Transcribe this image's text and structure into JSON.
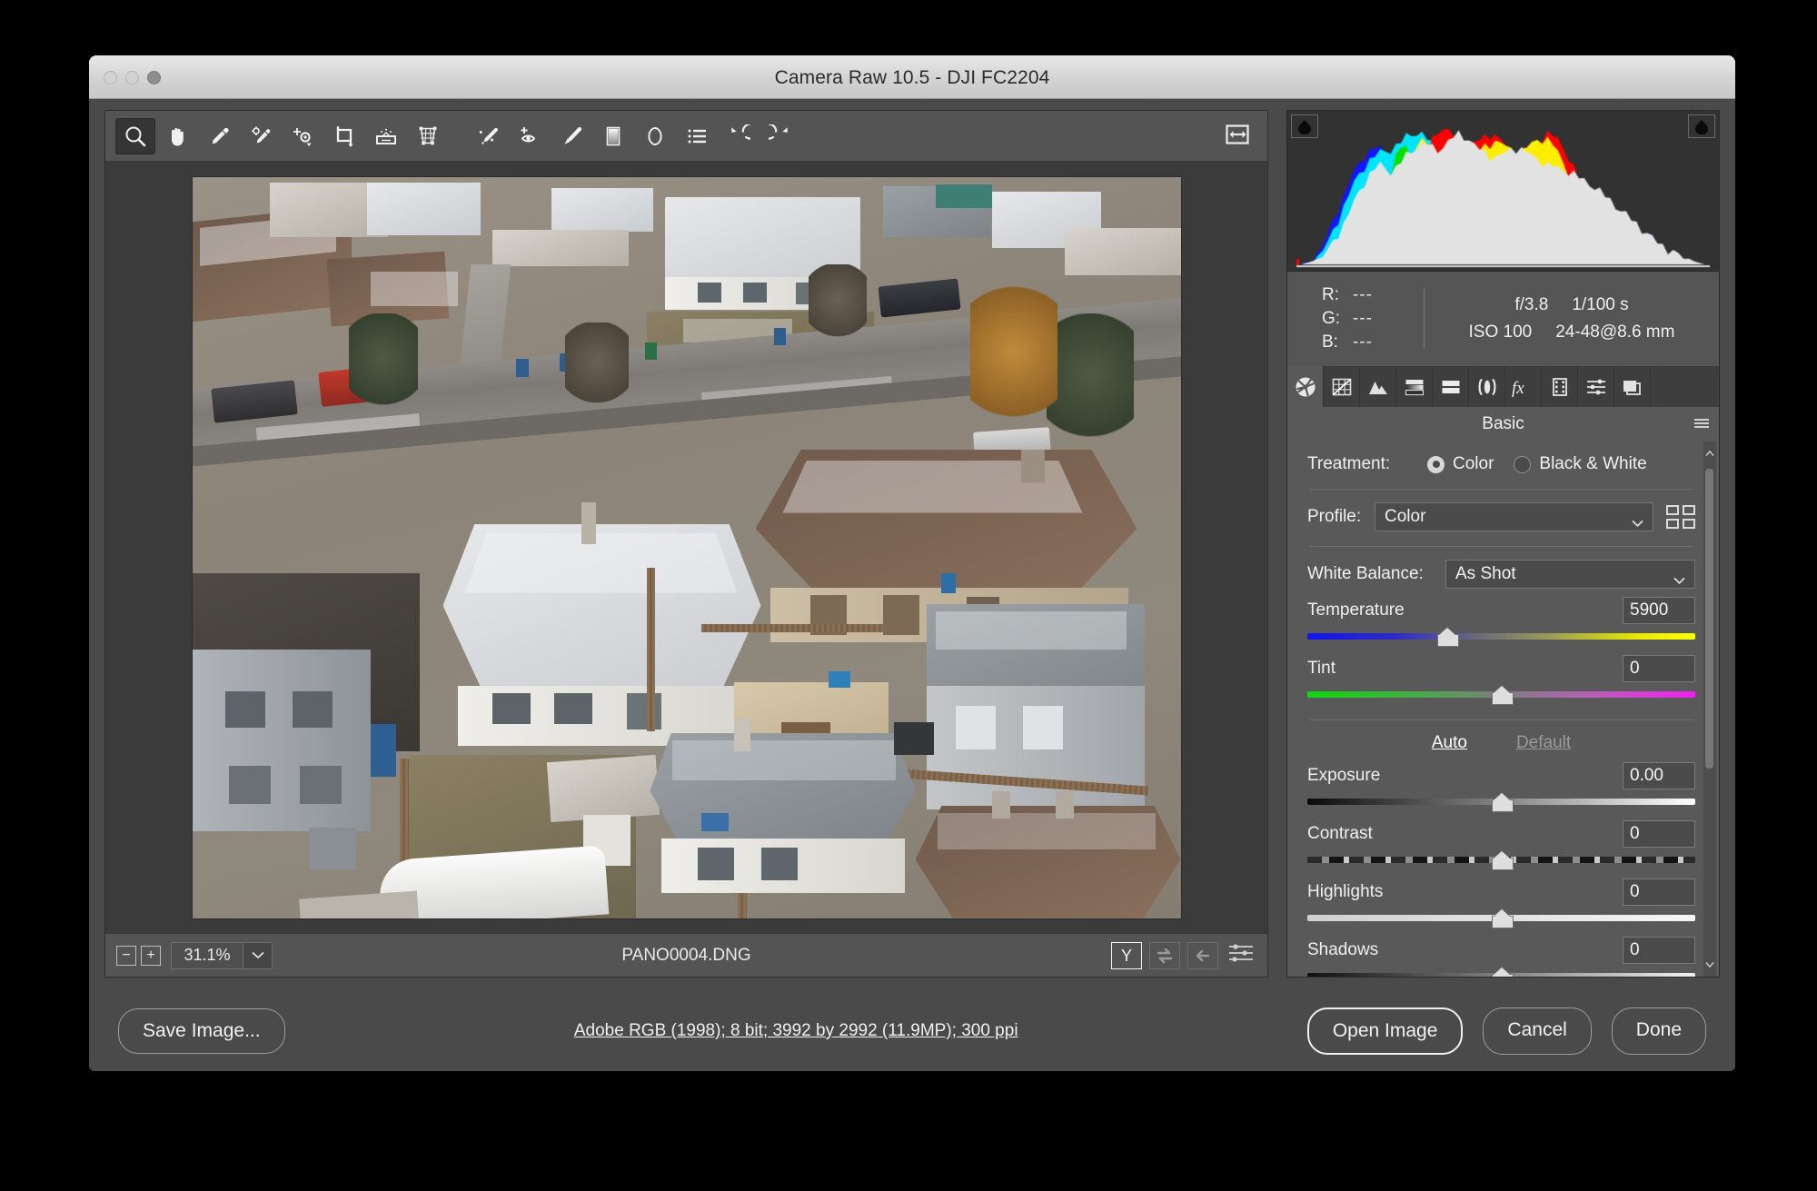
{
  "window": {
    "title": "Camera Raw 10.5  -  DJI FC2204",
    "traffic_lights": [
      "close",
      "minimize",
      "zoom"
    ]
  },
  "toolbar": {
    "tools": [
      {
        "name": "zoom-tool",
        "label": "Zoom Tool",
        "active": true
      },
      {
        "name": "hand-tool",
        "label": "Hand Tool",
        "active": false
      },
      {
        "name": "white-balance-tool",
        "label": "White Balance Tool",
        "active": false
      },
      {
        "name": "color-sampler-tool",
        "label": "Color Sampler Tool",
        "active": false
      },
      {
        "name": "targeted-adjustment-tool",
        "label": "Targeted Adjustment Tool",
        "active": false
      },
      {
        "name": "crop-tool",
        "label": "Crop Tool",
        "active": false
      },
      {
        "name": "straighten-tool",
        "label": "Straighten Tool",
        "active": false
      },
      {
        "name": "transform-tool",
        "label": "Transform Tool",
        "active": false
      },
      {
        "name": "spot-removal-tool",
        "label": "Spot Removal",
        "active": false
      },
      {
        "name": "red-eye-removal-tool",
        "label": "Red Eye Removal",
        "active": false
      },
      {
        "name": "adjustment-brush-tool",
        "label": "Adjustment Brush",
        "active": false
      },
      {
        "name": "graduated-filter-tool",
        "label": "Graduated Filter",
        "active": false
      },
      {
        "name": "radial-filter-tool",
        "label": "Radial Filter",
        "active": false
      },
      {
        "name": "preferences-tool",
        "label": "Open Preferences Dialog",
        "active": false
      },
      {
        "name": "rotate-left-tool",
        "label": "Rotate Image Counterclockwise",
        "active": false
      },
      {
        "name": "rotate-right-tool",
        "label": "Rotate Image Clockwise",
        "active": false
      }
    ],
    "fullscreen_toggle": "Toggle Full Screen Mode"
  },
  "histogram": {
    "shadow_clipping": "shadow-clipping-warning",
    "highlight_clipping": "highlight-clipping-warning"
  },
  "exif": {
    "readout": [
      {
        "channel": "R:",
        "value": "---"
      },
      {
        "channel": "G:",
        "value": "---"
      },
      {
        "channel": "B:",
        "value": "---"
      }
    ],
    "aperture": "f/3.8",
    "shutter": "1/100 s",
    "iso": "ISO 100",
    "lens": "24-48@8.6 mm"
  },
  "panel_tabs": [
    {
      "name": "tab-basic",
      "label": "Basic",
      "icon": "aperture-icon",
      "active": true
    },
    {
      "name": "tab-tone-curve",
      "label": "Tone Curve",
      "icon": "tone-curve-icon",
      "active": false
    },
    {
      "name": "tab-detail",
      "label": "Detail",
      "icon": "detail-icon",
      "active": false
    },
    {
      "name": "tab-hsl-grayscale",
      "label": "HSL / Grayscale",
      "icon": "hsl-icon",
      "active": false
    },
    {
      "name": "tab-split-toning",
      "label": "Split Toning",
      "icon": "split-toning-icon",
      "active": false
    },
    {
      "name": "tab-lens-corrections",
      "label": "Lens Corrections",
      "icon": "lens-corrections-icon",
      "active": false
    },
    {
      "name": "tab-effects",
      "label": "Effects",
      "icon": "fx-icon",
      "active": false
    },
    {
      "name": "tab-calibration",
      "label": "Camera Calibration",
      "icon": "filmstrip-icon",
      "active": false
    },
    {
      "name": "tab-presets",
      "label": "Presets",
      "icon": "sliders-icon",
      "active": false
    },
    {
      "name": "tab-snapshots",
      "label": "Snapshots",
      "icon": "stacked-layers-icon",
      "active": false
    }
  ],
  "basic_panel": {
    "title": "Basic",
    "menu_icon": "panel-menu-icon",
    "treatment": {
      "label": "Treatment:",
      "options": [
        {
          "label": "Color",
          "selected": true
        },
        {
          "label": "Black & White",
          "selected": false
        }
      ]
    },
    "profile": {
      "label": "Profile:",
      "value": "Color",
      "browser_icon": "profile-browser-icon"
    },
    "white_balance": {
      "label": "White Balance:",
      "value": "As Shot"
    },
    "auto_label": "Auto",
    "default_label": "Default",
    "sliders": [
      {
        "name": "temperature",
        "label": "Temperature",
        "value": "5900",
        "knob_pct": 36,
        "track": "t-temp"
      },
      {
        "name": "tint",
        "label": "Tint",
        "value": "0",
        "knob_pct": 50,
        "track": "t-tint"
      },
      {
        "name": "exposure",
        "label": "Exposure",
        "value": "0.00",
        "knob_pct": 50,
        "track": "t-exp"
      },
      {
        "name": "contrast",
        "label": "Contrast",
        "value": "0",
        "knob_pct": 50,
        "track": "t-contrast"
      },
      {
        "name": "highlights",
        "label": "Highlights",
        "value": "0",
        "knob_pct": 50,
        "track": "t-hi"
      },
      {
        "name": "shadows",
        "label": "Shadows",
        "value": "0",
        "knob_pct": 50,
        "track": "t-plain"
      }
    ]
  },
  "zoombar": {
    "zoom_out": "−",
    "zoom_in": "+",
    "zoom_level": "31.1%",
    "filename": "PANO0004.DNG",
    "before_after": "Y",
    "swap_button": "swap-before-after-icon",
    "copy_button": "copy-settings-icon",
    "settings_button": "preview-settings-icon"
  },
  "bottom": {
    "save_image": "Save Image...",
    "workflow": "Adobe RGB (1998); 8 bit; 3992 by 2992 (11.9MP); 300 ppi",
    "open_image": "Open Image",
    "cancel": "Cancel",
    "done": "Done"
  },
  "colors": {
    "window_bg": "#4a4a4a",
    "panel_bg": "#595959",
    "toolbar_bg": "#545454",
    "canvas_bg": "#3b3b3b",
    "histogram_bg": "#323232",
    "text": "#f0f0f0"
  },
  "histogram_shape": {
    "white": [
      0,
      0,
      1,
      2,
      3,
      5,
      9,
      14,
      20,
      26,
      33,
      40,
      47,
      53,
      58,
      62,
      64,
      62,
      60,
      62,
      66,
      70,
      73,
      76,
      78,
      77,
      75,
      74,
      76,
      79,
      82,
      84,
      83,
      80,
      77,
      74,
      72,
      70,
      69,
      70,
      72,
      74,
      75,
      74,
      72,
      70,
      68,
      66,
      64,
      63,
      62,
      61,
      60,
      58,
      56,
      54,
      52,
      50,
      47,
      44,
      41,
      38,
      35,
      32,
      29,
      26,
      23,
      20,
      17,
      14,
      12,
      10,
      8,
      6,
      4,
      3,
      2,
      1,
      0,
      0
    ],
    "blue": [
      0,
      0,
      2,
      4,
      7,
      12,
      19,
      27,
      36,
      44,
      52,
      59,
      65,
      70,
      73,
      75,
      74,
      71,
      67,
      68,
      72,
      76,
      78,
      79,
      80,
      78,
      74,
      70,
      66,
      62,
      58,
      54,
      50,
      46,
      42,
      38,
      35,
      32,
      29,
      27,
      25,
      23,
      21,
      20,
      19,
      18,
      17,
      16,
      15,
      14,
      13,
      13,
      12,
      12,
      11,
      11,
      10,
      10,
      10,
      10,
      11,
      12,
      14,
      16,
      18,
      20,
      21,
      20,
      17,
      13,
      9,
      6,
      4,
      2,
      1,
      0,
      0,
      0,
      0,
      0
    ],
    "cyan": [
      0,
      0,
      1,
      3,
      5,
      9,
      14,
      21,
      29,
      37,
      45,
      52,
      58,
      63,
      67,
      70,
      72,
      73,
      74,
      76,
      79,
      82,
      84,
      85,
      84,
      81,
      77,
      72,
      67,
      62,
      57,
      52,
      48,
      44,
      40,
      37,
      34,
      31,
      29,
      27,
      25,
      23,
      22,
      21,
      20,
      19,
      18,
      17,
      17,
      16,
      16,
      15,
      15,
      14,
      14,
      13,
      13,
      13,
      13,
      14,
      15,
      16,
      18,
      20,
      22,
      23,
      22,
      19,
      15,
      11,
      7,
      4,
      2,
      1,
      0,
      0,
      0,
      0,
      0,
      0
    ],
    "red": [
      0,
      0,
      0,
      0,
      0,
      0,
      0,
      0,
      0,
      0,
      0,
      0,
      0,
      0,
      0,
      0,
      0,
      0,
      0,
      2,
      6,
      14,
      26,
      40,
      56,
      70,
      80,
      86,
      88,
      86,
      83,
      80,
      78,
      77,
      78,
      80,
      82,
      84,
      83,
      80,
      76,
      73,
      71,
      70,
      72,
      75,
      79,
      82,
      84,
      83,
      80,
      75,
      69,
      62,
      54,
      46,
      38,
      31,
      25,
      20,
      16,
      12,
      9,
      7,
      5,
      3,
      2,
      1,
      0,
      0,
      0,
      0,
      0,
      0,
      0,
      0,
      0,
      0,
      0,
      0
    ],
    "yellow": [
      0,
      0,
      0,
      0,
      0,
      0,
      0,
      0,
      0,
      0,
      0,
      0,
      0,
      0,
      0,
      0,
      2,
      6,
      14,
      26,
      42,
      58,
      70,
      78,
      80,
      78,
      74,
      70,
      67,
      65,
      64,
      64,
      65,
      67,
      70,
      73,
      76,
      78,
      79,
      78,
      76,
      74,
      73,
      73,
      75,
      78,
      80,
      81,
      80,
      77,
      72,
      66,
      59,
      52,
      45,
      38,
      32,
      26,
      21,
      17,
      13,
      10,
      8,
      6,
      4,
      3,
      2,
      1,
      0,
      0,
      0,
      0,
      0,
      0,
      0,
      0,
      0,
      0,
      0,
      0
    ],
    "green": [
      0,
      0,
      0,
      0,
      0,
      0,
      0,
      0,
      0,
      0,
      0,
      0,
      0,
      2,
      6,
      14,
      26,
      42,
      58,
      70,
      76,
      74,
      68,
      60,
      52,
      45,
      39,
      34,
      30,
      27,
      25,
      23,
      22,
      21,
      21,
      22,
      23,
      25,
      27,
      29,
      31,
      33,
      34,
      34,
      33,
      32,
      30,
      28,
      26,
      24,
      22,
      20,
      18,
      16,
      14,
      12,
      11,
      10,
      10,
      11,
      13,
      15,
      17,
      18,
      17,
      14,
      11,
      8,
      5,
      3,
      2,
      1,
      0,
      0,
      0,
      0,
      0,
      0,
      0,
      0
    ],
    "magenta": [
      0,
      0,
      0,
      0,
      0,
      0,
      0,
      0,
      0,
      0,
      0,
      0,
      0,
      0,
      0,
      0,
      0,
      0,
      0,
      0,
      0,
      0,
      0,
      0,
      0,
      0,
      0,
      0,
      0,
      0,
      0,
      0,
      0,
      0,
      0,
      0,
      0,
      2,
      4,
      6,
      5,
      4,
      3,
      3,
      4,
      6,
      8,
      10,
      12,
      13,
      12,
      10,
      8,
      7,
      6,
      5,
      5,
      6,
      7,
      8,
      9,
      8,
      7,
      5,
      4,
      3,
      2,
      1,
      0,
      0,
      0,
      0,
      0,
      0,
      0,
      0,
      0,
      0,
      0,
      0
    ]
  }
}
